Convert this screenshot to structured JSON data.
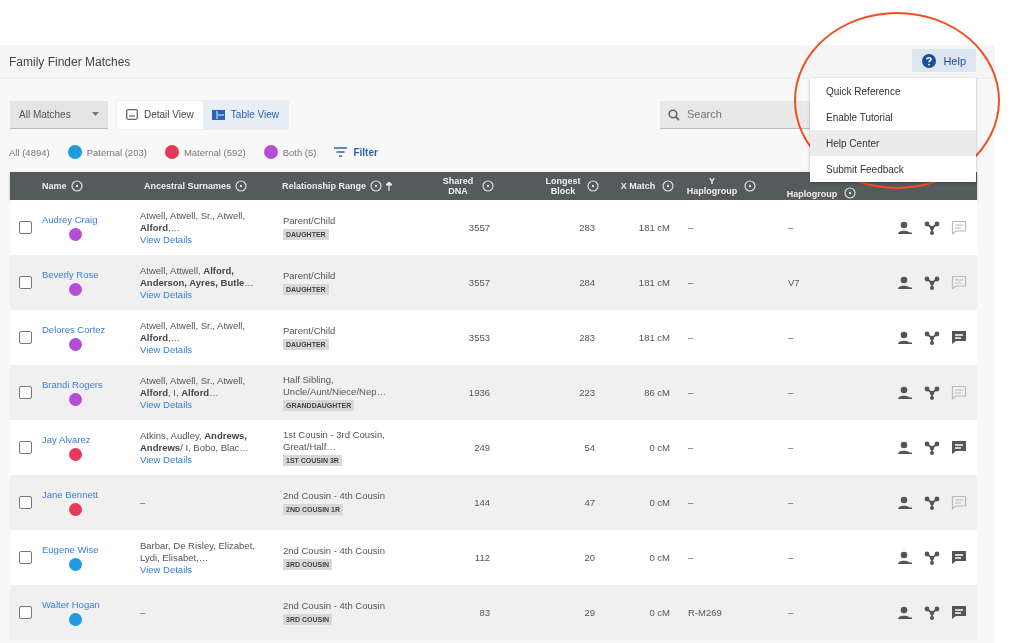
{
  "page": {
    "title": "Family Finder Matches"
  },
  "help_button": {
    "label": "Help"
  },
  "help_menu": {
    "items": [
      {
        "label": "Quick Reference",
        "selected": false
      },
      {
        "label": "Enable Tutorial",
        "selected": false
      },
      {
        "label": "Help Center",
        "selected": true
      },
      {
        "label": "Submit Feedback",
        "selected": false
      }
    ]
  },
  "toolbar": {
    "match_filter": "All Matches",
    "views": [
      {
        "label": "Detail View",
        "selected": false
      },
      {
        "label": "Table View",
        "selected": true
      }
    ],
    "search": {
      "placeholder": "Search"
    }
  },
  "filters": [
    {
      "kind": "plain",
      "label": "All (4894)"
    },
    {
      "kind": "side",
      "label": "Paternal (203)",
      "color": "#1e9be0"
    },
    {
      "kind": "side",
      "label": "Maternal (592)",
      "color": "#e8395a"
    },
    {
      "kind": "side",
      "label": "Both (5)",
      "color": "#b44ed6"
    },
    {
      "kind": "action",
      "label": "Filter"
    }
  ],
  "table": {
    "columns": [
      {
        "label": "Name",
        "sorted": false
      },
      {
        "label": "Ancestral Surnames",
        "sorted": false
      },
      {
        "label": "Relationship Range",
        "sorted": true
      },
      {
        "label": "Shared DNA",
        "sorted": false
      },
      {
        "label": "Longest Block",
        "sorted": false
      },
      {
        "label": "X Match",
        "sorted": false
      },
      {
        "label": "Y Haplogroup",
        "sorted": false
      },
      {
        "label": "Haplogroup",
        "sorted": false
      }
    ],
    "rows": [
      {
        "name": "Audrey Craig",
        "color": "#b44ed6",
        "checked": false,
        "surnames": "Atwell, Atwell, Sr., Atwell, **Alford**,…",
        "details": "View Details",
        "relationship": "Parent/Child",
        "tag": "DAUGHTER",
        "shared": "3557",
        "longest": "283",
        "x_match": "181 cM",
        "y_haplogroup": "–",
        "mt_haplogroup": "–",
        "has_note": false
      },
      {
        "name": "Beverly Rose",
        "color": "#b44ed6",
        "checked": false,
        "surnames": "Atwell, Attwell, **Alford, Anderson, Ayres, Butle**…",
        "details": "View Details",
        "relationship": "Parent/Child",
        "tag": "DAUGHTER",
        "shared": "3557",
        "longest": "284",
        "x_match": "181 cM",
        "y_haplogroup": "–",
        "mt_haplogroup": "V7",
        "has_note": false
      },
      {
        "name": "Delores Cortez",
        "color": "#b44ed6",
        "checked": false,
        "surnames": "Atwell, Atwell, Sr., Atwell, **Alford**,…",
        "details": "View Details",
        "relationship": "Parent/Child",
        "tag": "DAUGHTER",
        "shared": "3553",
        "longest": "283",
        "x_match": "181 cM",
        "y_haplogroup": "–",
        "mt_haplogroup": "–",
        "has_note": true
      },
      {
        "name": "Brandi Rogers",
        "color": "#b44ed6",
        "checked": false,
        "surnames": "Atwell, Atwell, Sr., Atwell, **Alford**, I, **Alford**…",
        "details": "View Details",
        "relationship": "Half Sibling, Uncle/Aunt/Niece/Nep…",
        "tag": "GRANDDAUGHTER",
        "shared": "1936",
        "longest": "223",
        "x_match": "86 cM",
        "y_haplogroup": "–",
        "mt_haplogroup": "–",
        "has_note": false
      },
      {
        "name": "Jay Alvarez",
        "color": "#e8395a",
        "checked": false,
        "surnames": "Atkins, Audley, **Andrews, Andrews**/ I, Bobo, Blac…",
        "details": "View Details",
        "relationship": "1st Cousin - 3rd Cousin, Great/Half…",
        "tag": "1ST COUSIN 3R",
        "shared": "249",
        "longest": "54",
        "x_match": "0 cM",
        "y_haplogroup": "–",
        "mt_haplogroup": "–",
        "has_note": true
      },
      {
        "name": "Jane Bennett",
        "color": "#e8395a",
        "checked": false,
        "surnames": "–",
        "relationship": "2nd Cousin - 4th Cousin",
        "tag": "2ND COUSIN 1R",
        "shared": "144",
        "longest": "47",
        "x_match": "0 cM",
        "y_haplogroup": "–",
        "mt_haplogroup": "–",
        "has_note": false
      },
      {
        "name": "Eugene Wise",
        "color": "#1e9be0",
        "checked": false,
        "surnames": "Barbar, De Risley, Elizabet, Lydi, Elisabet,…",
        "details": "View Details",
        "relationship": "2nd Cousin - 4th Cousin",
        "tag": "3RD COUSIN",
        "shared": "112",
        "longest": "20",
        "x_match": "0 cM",
        "y_haplogroup": "–",
        "mt_haplogroup": "–",
        "has_note": true
      },
      {
        "name": "Walter Hogan",
        "color": "#1e9be0",
        "checked": false,
        "surnames": "–",
        "relationship": "2nd Cousin - 4th Cousin",
        "tag": "3RD COUSIN",
        "shared": "83",
        "longest": "29",
        "x_match": "0 cM",
        "y_haplogroup": "R-M269",
        "mt_haplogroup": "–",
        "has_note": true
      }
    ]
  }
}
